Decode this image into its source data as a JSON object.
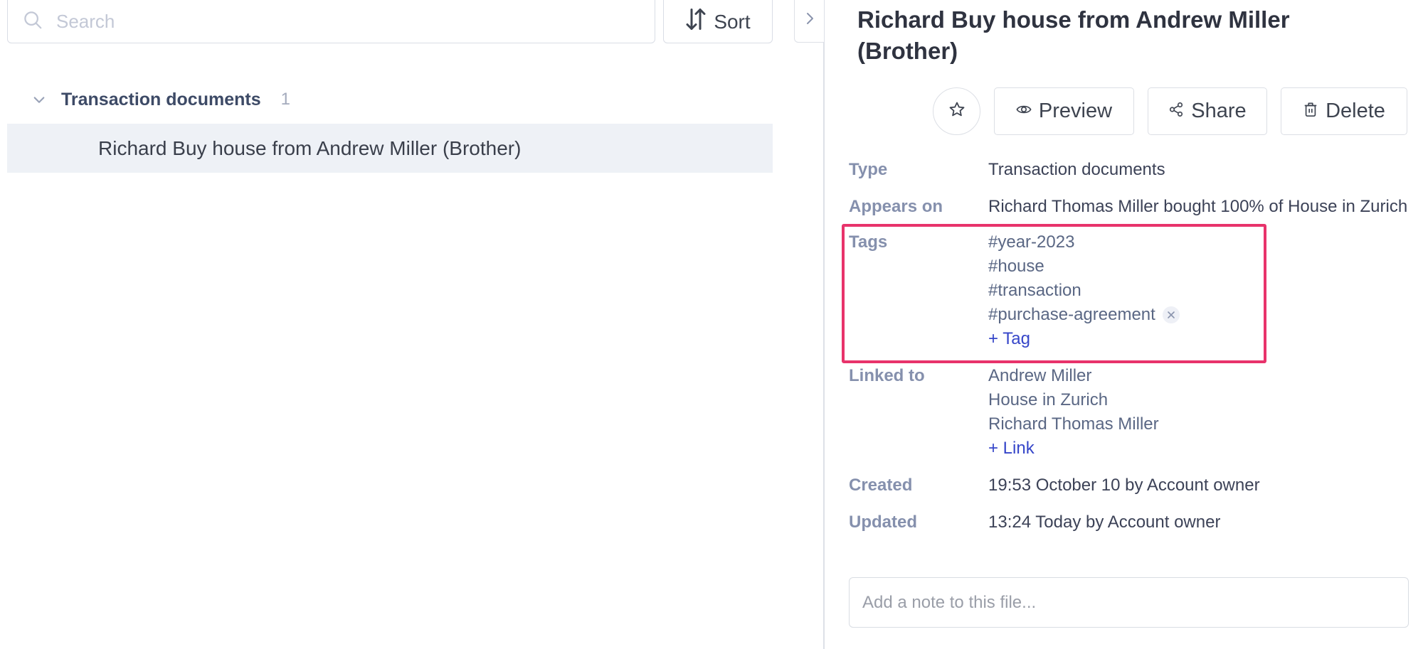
{
  "search": {
    "placeholder": "Search",
    "value": ""
  },
  "toolbar": {
    "sort_label": "Sort"
  },
  "list": {
    "group": {
      "label": "Transaction documents",
      "count": "1"
    },
    "items": [
      {
        "label": "Richard Buy house from Andrew Miller (Brother)",
        "selected": true
      }
    ]
  },
  "detail": {
    "title": "Richard Buy house from Andrew Miller (Brother)",
    "actions": {
      "preview": "Preview",
      "share": "Share",
      "delete": "Delete"
    },
    "properties": {
      "type": {
        "label": "Type",
        "value": "Transaction documents"
      },
      "appears_on": {
        "label": "Appears on",
        "value": "Richard Thomas Miller bought 100% of House in Zurich"
      },
      "tags": {
        "label": "Tags",
        "items": [
          "#year-2023",
          "#house",
          "#transaction",
          "#purchase-agreement"
        ],
        "add_label": "+ Tag"
      },
      "linked_to": {
        "label": "Linked to",
        "items": [
          "Andrew Miller",
          "House in Zurich",
          "Richard Thomas Miller"
        ],
        "add_label": "+ Link"
      },
      "created": {
        "label": "Created",
        "value": "19:53 October 10 by Account owner"
      },
      "updated": {
        "label": "Updated",
        "value": "13:24 Today by Account owner"
      }
    },
    "note": {
      "placeholder": "Add a note to this file...",
      "value": ""
    }
  },
  "colors": {
    "highlight": "#e8336b",
    "link_blue": "#3646c9",
    "label": "#8590ad",
    "selected_row": "#eef1f6"
  }
}
